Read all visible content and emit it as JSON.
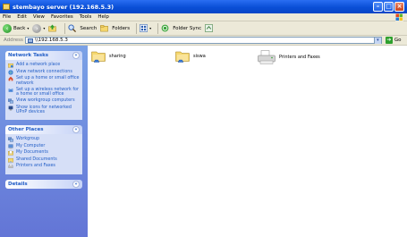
{
  "window": {
    "title": "stembayo server (192.168.5.3)"
  },
  "menu": [
    "File",
    "Edit",
    "View",
    "Favorites",
    "Tools",
    "Help"
  ],
  "toolbar": {
    "back": "Back",
    "search": "Search",
    "folders": "Folders",
    "folder_sync": "Folder Sync"
  },
  "address": {
    "label": "Address",
    "value": "\\\\192.168.5.3",
    "go": "Go"
  },
  "sidebar": {
    "network_tasks": {
      "title": "Network Tasks",
      "items": [
        "Add a network place",
        "View network connections",
        "Set up a home or small office network",
        "Set up a wireless network for a home or small office",
        "View workgroup computers",
        "Show icons for networked UPnP devices"
      ]
    },
    "other_places": {
      "title": "Other Places",
      "items": [
        "Workgroup",
        "My Computer",
        "My Documents",
        "Shared Documents",
        "Printers and Faxes"
      ]
    },
    "details": {
      "title": "Details"
    }
  },
  "content": {
    "items": [
      {
        "name": "sharing"
      },
      {
        "name": "siswa"
      },
      {
        "name": "Printers and Faxes"
      }
    ]
  }
}
